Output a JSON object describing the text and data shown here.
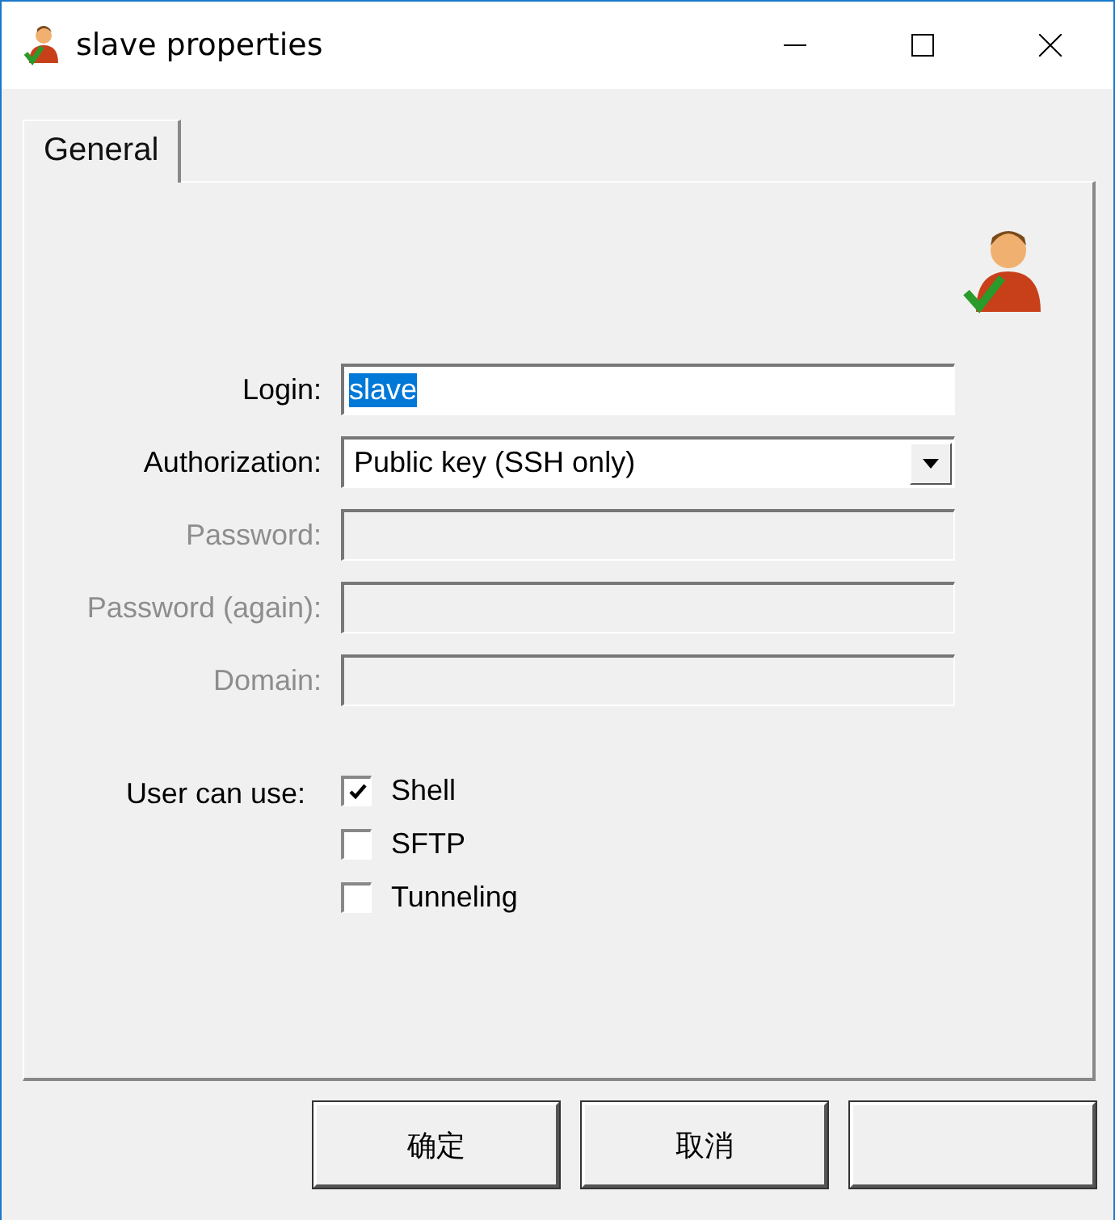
{
  "window": {
    "title": "slave properties"
  },
  "tabs": [
    {
      "label": "General",
      "selected": true
    }
  ],
  "fields": [
    {
      "kind": "text",
      "label": "Login:",
      "value": "slave",
      "disabled": false,
      "text_selected": true
    },
    {
      "kind": "dropdown",
      "label": "Authorization:",
      "value": "Public key (SSH only)",
      "disabled": false
    },
    {
      "kind": "text",
      "label": "Password:",
      "disabled": true
    },
    {
      "kind": "text",
      "label": "Password (again):",
      "disabled": true
    },
    {
      "kind": "text",
      "label": "Domain:",
      "disabled": true
    }
  ],
  "permissions": {
    "label": "User can use:",
    "options": [
      {
        "label": "Shell",
        "checked": true
      },
      {
        "label": "SFTP",
        "checked": false
      },
      {
        "label": "Tunneling",
        "checked": false
      }
    ]
  },
  "buttons": [
    {
      "kind": "push",
      "label": "确定"
    },
    {
      "kind": "push",
      "label": "取消"
    },
    {
      "kind": "push"
    }
  ]
}
